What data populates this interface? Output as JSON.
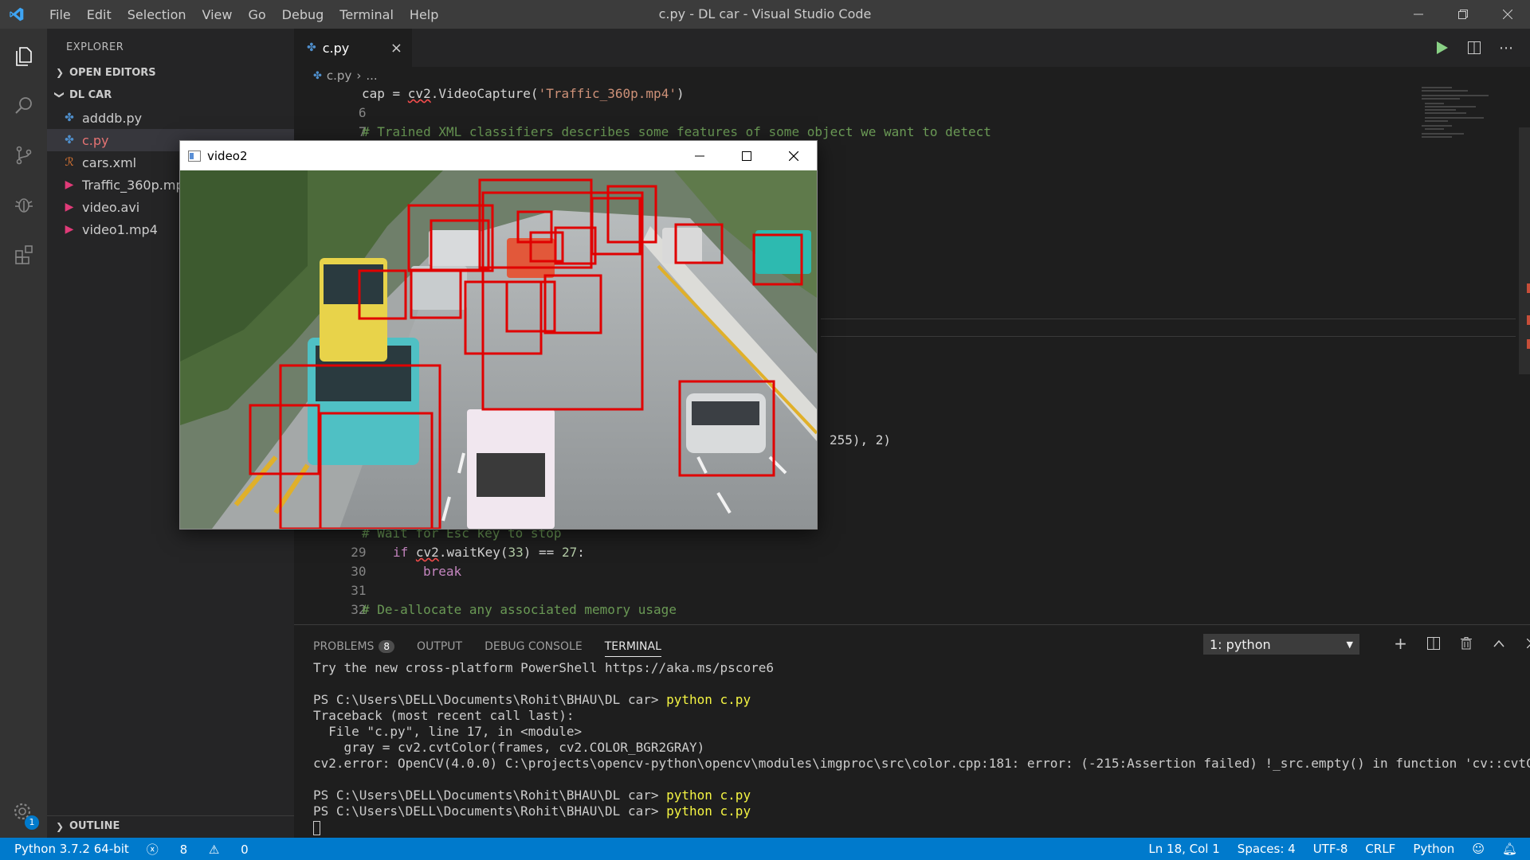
{
  "window": {
    "title": "c.py - DL car - Visual Studio Code",
    "menu": [
      "File",
      "Edit",
      "Selection",
      "View",
      "Go",
      "Debug",
      "Terminal",
      "Help"
    ]
  },
  "sidebar": {
    "title": "EXPLORER",
    "open_editors": "OPEN EDITORS",
    "folder": "DL CAR",
    "files": [
      {
        "name": "adddb.py",
        "icon": "python-file-icon"
      },
      {
        "name": "c.py",
        "icon": "python-file-icon"
      },
      {
        "name": "cars.xml",
        "icon": "rss-xml-icon"
      },
      {
        "name": "Traffic_360p.mp4",
        "icon": "video-file-icon"
      },
      {
        "name": "video.avi",
        "icon": "video-file-icon"
      },
      {
        "name": "video1.mp4",
        "icon": "video-file-icon"
      }
    ],
    "outline": "OUTLINE",
    "settings_badge": "1"
  },
  "editor": {
    "tab": "c.py",
    "breadcrumb": [
      "c.py",
      "..."
    ],
    "lines": [
      {
        "n": "6",
        "text": "cap = cv2.VideoCapture('Traffic_360p.mp4')"
      },
      {
        "n": "7",
        "text": ""
      },
      {
        "n": "8",
        "text": "# Trained XML classifiers describes some features of some object we want to detect"
      },
      {
        "n": "29",
        "text": "# Wait for Esc key to stop"
      },
      {
        "n": "30",
        "text": "if cv2.waitKey(33) == 27:"
      },
      {
        "n": "31",
        "text": "break"
      },
      {
        "n": "32",
        "text": ""
      },
      {
        "n": "33",
        "text": "# De-allocate any associated memory usage"
      }
    ],
    "visible_fragment": "255), 2)"
  },
  "panel": {
    "tabs": [
      "PROBLEMS",
      "OUTPUT",
      "DEBUG CONSOLE",
      "TERMINAL"
    ],
    "problems_count": "8",
    "terminal_select": "1: python",
    "terminal_lines": [
      {
        "prompt": "Try the new cross-platform PowerShell https://aka.ms/pscore6",
        "cmd": ""
      },
      {
        "prompt": "",
        "cmd": ""
      },
      {
        "prompt": "PS C:\\Users\\DELL\\Documents\\Rohit\\BHAU\\DL car> ",
        "cmd": "python c.py"
      },
      {
        "prompt": "Traceback (most recent call last):",
        "cmd": ""
      },
      {
        "prompt": "  File \"c.py\", line 17, in <module>",
        "cmd": ""
      },
      {
        "prompt": "    gray = cv2.cvtColor(frames, cv2.COLOR_BGR2GRAY)",
        "cmd": ""
      },
      {
        "prompt": "cv2.error: OpenCV(4.0.0) C:\\projects\\opencv-python\\opencv\\modules\\imgproc\\src\\color.cpp:181: error: (-215:Assertion failed) !_src.empty() in function 'cv::cvtColor'",
        "cmd": ""
      },
      {
        "prompt": "",
        "cmd": ""
      },
      {
        "prompt": "PS C:\\Users\\DELL\\Documents\\Rohit\\BHAU\\DL car> ",
        "cmd": "python c.py"
      },
      {
        "prompt": "PS C:\\Users\\DELL\\Documents\\Rohit\\BHAU\\DL car> ",
        "cmd": "python c.py"
      }
    ]
  },
  "video_window": {
    "title": "video2"
  },
  "statusbar": {
    "python": "Python 3.7.2 64-bit",
    "errors": "8",
    "warnings": "0",
    "position": "Ln 18, Col 1",
    "spaces": "Spaces: 4",
    "encoding": "UTF-8",
    "eol": "CRLF",
    "language": "Python"
  },
  "colors": {
    "accent": "#007acc",
    "detection_box": "#e00000"
  }
}
